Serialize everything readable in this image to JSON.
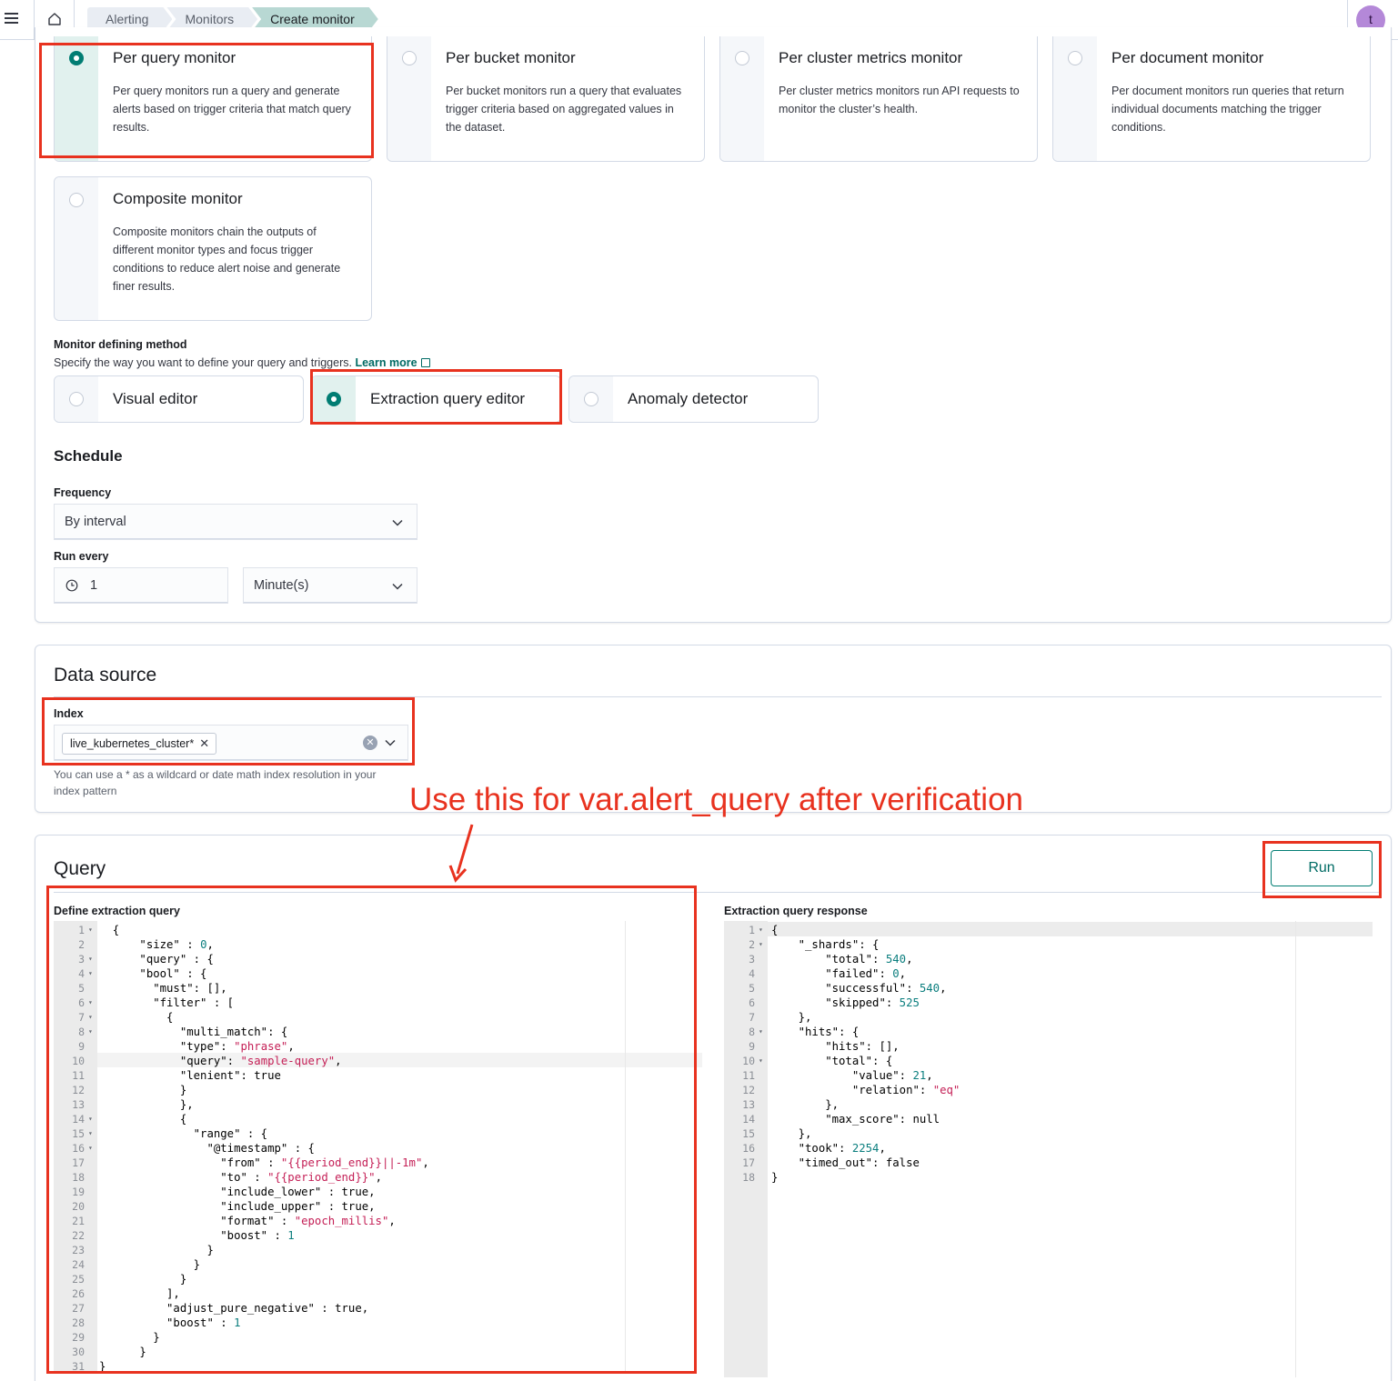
{
  "header": {
    "breadcrumbs": [
      "Alerting",
      "Monitors",
      "Create monitor"
    ],
    "avatar_initial": "t"
  },
  "monitor_types": [
    {
      "title": "Per query monitor",
      "desc": "Per query monitors run a query and generate alerts based on trigger criteria that match query results.",
      "selected": true
    },
    {
      "title": "Per bucket monitor",
      "desc": "Per bucket monitors run a query that evaluates trigger criteria based on aggregated values in the dataset.",
      "selected": false
    },
    {
      "title": "Per cluster metrics monitor",
      "desc": "Per cluster metrics monitors run API requests to monitor the cluster’s health.",
      "selected": false
    },
    {
      "title": "Per document monitor",
      "desc": "Per document monitors run queries that return individual documents matching the trigger conditions.",
      "selected": false
    },
    {
      "title": "Composite monitor",
      "desc": "Composite monitors chain the outputs of different monitor types and focus trigger conditions to reduce alert noise and generate finer results.",
      "selected": false
    }
  ],
  "defining_method": {
    "label": "Monitor defining method",
    "help": "Specify the way you want to define your query and triggers.",
    "learn_more": "Learn more",
    "options": [
      {
        "title": "Visual editor",
        "selected": false
      },
      {
        "title": "Extraction query editor",
        "selected": true
      },
      {
        "title": "Anomaly detector",
        "selected": false
      }
    ]
  },
  "schedule": {
    "title": "Schedule",
    "frequency_label": "Frequency",
    "frequency_value": "By interval",
    "run_every_label": "Run every",
    "run_every_value": "1",
    "run_every_unit": "Minute(s)"
  },
  "data_source": {
    "title": "Data source",
    "index_label": "Index",
    "index_value": "live_kubernetes_cluster*",
    "help": "You can use a * as a wildcard or date math index resolution in your index pattern"
  },
  "query": {
    "title": "Query",
    "run_label": "Run",
    "define_label": "Define extraction query",
    "response_label": "Extraction query response",
    "define_lines": [
      "  {",
      "      \"size\" : 0,",
      "      \"query\" : {",
      "      \"bool\" : {",
      "        \"must\": [],",
      "        \"filter\" : [",
      "          {",
      "            \"multi_match\": {",
      "            \"type\": \"phrase\",",
      "            \"query\": \"sample-query\",",
      "            \"lenient\": true",
      "            }",
      "            },",
      "            {",
      "              \"range\" : {",
      "                \"@timestamp\" : {",
      "                  \"from\" : \"{{period_end}}||-1m\",",
      "                  \"to\" : \"{{period_end}}\",",
      "                  \"include_lower\" : true,",
      "                  \"include_upper\" : true,",
      "                  \"format\" : \"epoch_millis\",",
      "                  \"boost\" : 1",
      "                }",
      "              }",
      "            }",
      "          ],",
      "          \"adjust_pure_negative\" : true,",
      "          \"boost\" : 1",
      "        }",
      "      }",
      "}"
    ],
    "response_lines": [
      "{",
      "    \"_shards\": {",
      "        \"total\": 540,",
      "        \"failed\": 0,",
      "        \"successful\": 540,",
      "        \"skipped\": 525",
      "    },",
      "    \"hits\": {",
      "        \"hits\": [],",
      "        \"total\": {",
      "            \"value\": 21,",
      "            \"relation\": \"eq\"",
      "        },",
      "        \"max_score\": null",
      "    },",
      "    \"took\": 2254,",
      "    \"timed_out\": false",
      "}"
    ]
  },
  "annotation": {
    "text": "Use this for var.alert_query after verification"
  },
  "colors": {
    "accent": "#017d73",
    "annotation": "#e8321f"
  }
}
